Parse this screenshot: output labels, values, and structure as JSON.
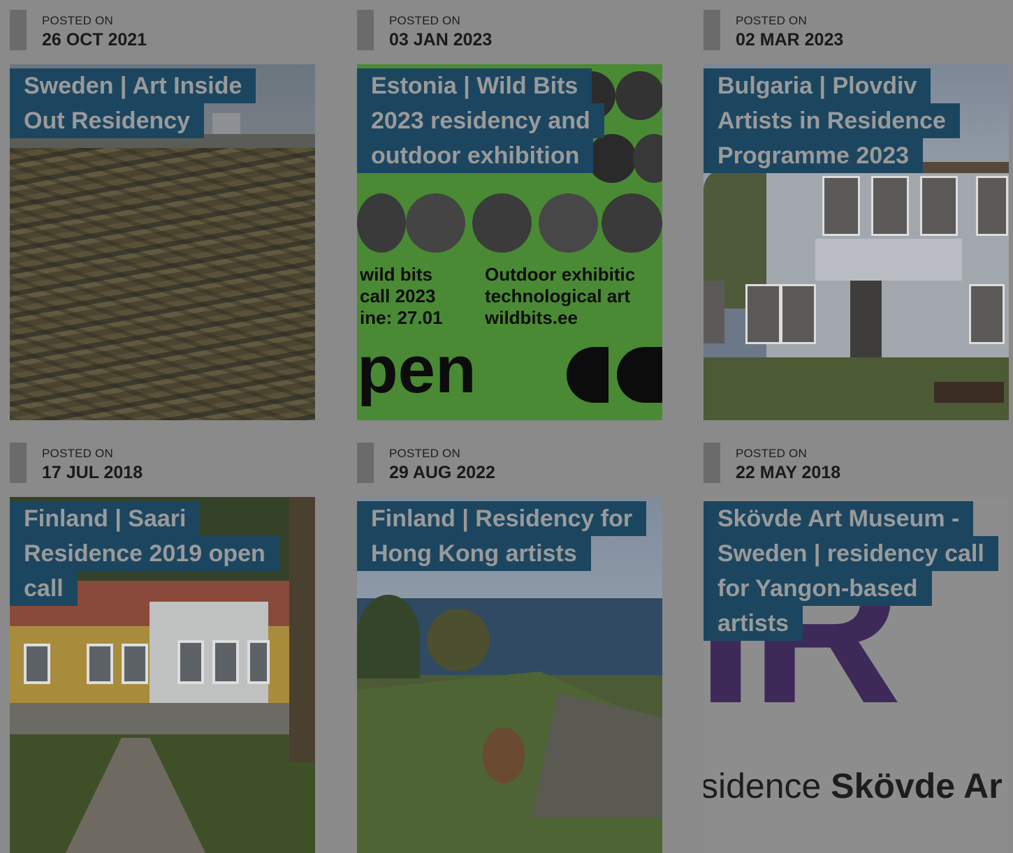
{
  "colors": {
    "page_overlay": "#8a8a8a",
    "title_background": "#1c4660",
    "title_text": "#9a9a9a",
    "date_bar": "#6b6b6b"
  },
  "posts": [
    {
      "posted_label": "POSTED ON",
      "date": "26 OCT 2021",
      "title_lines": [
        "Sweden | Art Inside",
        "Out Residency"
      ]
    },
    {
      "posted_label": "POSTED ON",
      "date": "03 JAN 2023",
      "title_lines": [
        "Estonia | Wild Bits",
        "2023 residency and",
        "outdoor exhibition"
      ],
      "image_text": {
        "left_lines": [
          "wild bits",
          "call 2023",
          "ine: 27.01"
        ],
        "right_lines": [
          "Outdoor exhibitic",
          "technological art",
          "wildbits.ee"
        ],
        "big": "pen"
      }
    },
    {
      "posted_label": "POSTED ON",
      "date": "02 MAR 2023",
      "title_lines": [
        "Bulgaria | Plovdiv",
        "Artists in Residence",
        "Programme 2023"
      ]
    },
    {
      "posted_label": "POSTED ON",
      "date": "17 JUL 2018",
      "title_lines": [
        "Finland | Saari",
        "Residence 2019 open",
        "call"
      ]
    },
    {
      "posted_label": "POSTED ON",
      "date": "29 AUG 2022",
      "title_lines": [
        "Finland | Residency for",
        "Hong Kong artists"
      ]
    },
    {
      "posted_label": "POSTED ON",
      "date": "22 MAY 2018",
      "title_lines": [
        "Skövde Art Museum -",
        "Sweden | residency call",
        "for Yangon-based",
        "artists"
      ],
      "image_text": {
        "logo_letters": "IR",
        "caption_light": "sidence",
        "caption_bold": "Skövde Ar"
      }
    }
  ]
}
